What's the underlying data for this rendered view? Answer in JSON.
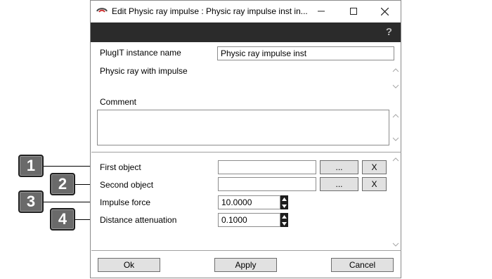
{
  "window": {
    "title": "Edit Physic ray impulse : Physic ray impulse inst in...",
    "help_glyph": "?"
  },
  "header": {
    "instance_name_label": "PlugIT instance name",
    "instance_name_value": "Physic ray impulse inst",
    "description": "Physic ray with impulse",
    "comment_label": "Comment",
    "comment_value": ""
  },
  "params": {
    "first_object_label": "First object",
    "first_object_value": "",
    "second_object_label": "Second object",
    "second_object_value": "",
    "browse_label": "...",
    "clear_label": "X",
    "impulse_force_label": "Impulse force",
    "impulse_force_value": "10.0000",
    "distance_attenuation_label": "Distance attenuation",
    "distance_attenuation_value": "0.1000"
  },
  "footer": {
    "ok_label": "Ok",
    "apply_label": "Apply",
    "cancel_label": "Cancel"
  },
  "callouts": [
    "1",
    "2",
    "3",
    "4"
  ]
}
